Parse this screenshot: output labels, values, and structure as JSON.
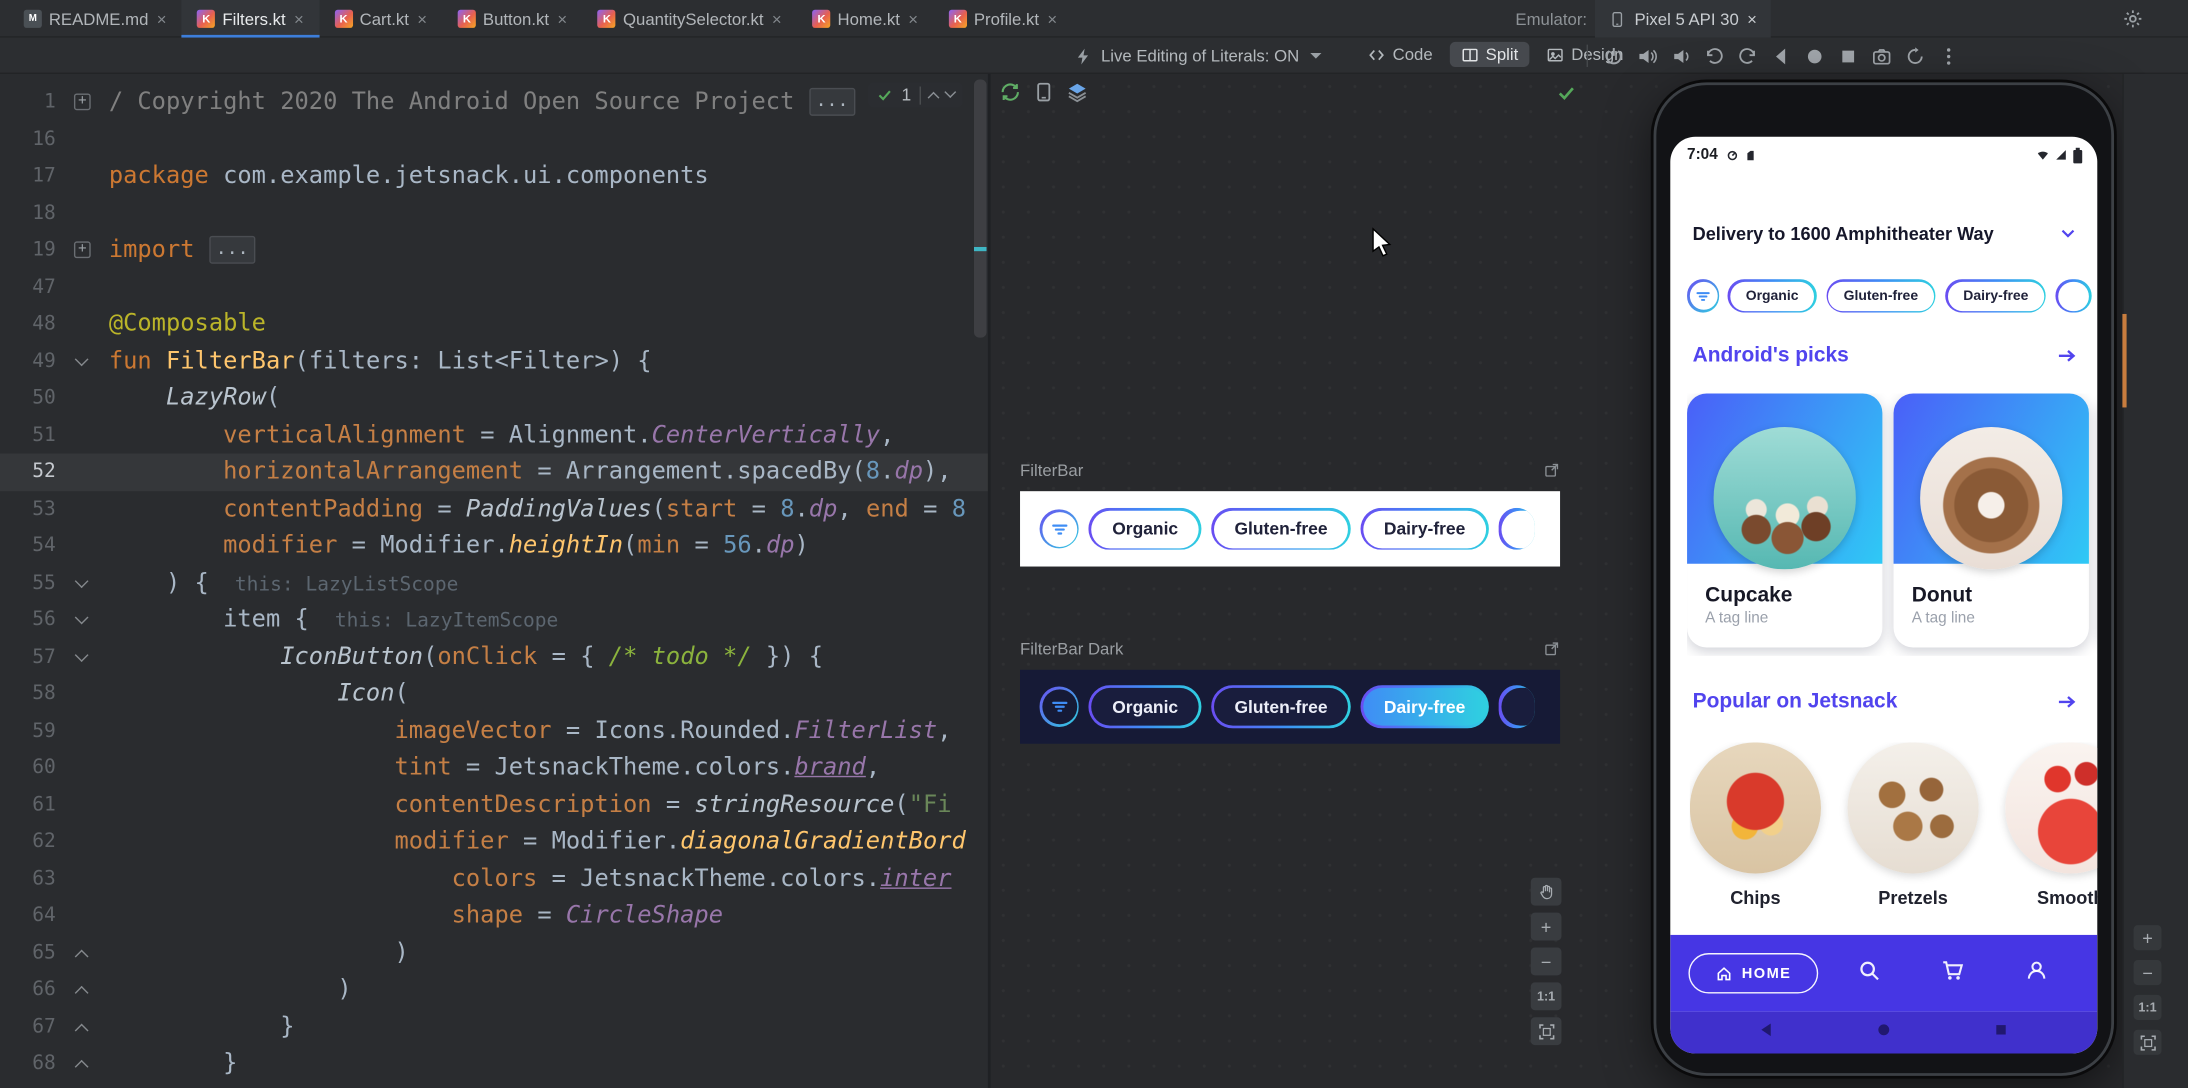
{
  "window": {
    "close_glyph": "×",
    "settings_icon": "settings-gear-icon"
  },
  "tabs": [
    {
      "label": "README.md",
      "badge": "M",
      "kind": "md",
      "active": false
    },
    {
      "label": "Filters.kt",
      "badge": "K",
      "kind": "kt",
      "active": true
    },
    {
      "label": "Cart.kt",
      "badge": "K",
      "kind": "kt",
      "active": false
    },
    {
      "label": "Button.kt",
      "badge": "K",
      "kind": "kt",
      "active": false
    },
    {
      "label": "QuantitySelector.kt",
      "badge": "K",
      "kind": "kt",
      "active": false
    },
    {
      "label": "Home.kt",
      "badge": "K",
      "kind": "kt",
      "active": false
    },
    {
      "label": "Profile.kt",
      "badge": "K",
      "kind": "kt",
      "active": false
    }
  ],
  "emulator_panel": {
    "prefix": "Emulator:",
    "tab": "Pixel 5 API 30",
    "tab_icon": "phone-icon"
  },
  "toolbar": {
    "live_edit_icon": "live-edit-bolt-icon",
    "live_edit": "Live Editing of Literals: ON",
    "view_modes": [
      {
        "label": "Code",
        "icon": "code-view-icon",
        "active": false
      },
      {
        "label": "Split",
        "icon": "split-view-icon",
        "active": true
      },
      {
        "label": "Design",
        "icon": "design-view-icon",
        "active": false
      }
    ],
    "emulator_buttons": [
      "power-icon",
      "volume-up-icon",
      "volume-down-icon",
      "rotate-left-icon",
      "rotate-right-icon",
      "back-icon",
      "home-circle-icon",
      "overview-square-icon",
      "camera-icon",
      "snapshot-icon",
      "more-kebab-icon"
    ]
  },
  "inspection": {
    "count": "1"
  },
  "editor": {
    "lines": [
      {
        "n": "1",
        "fold": "plus",
        "s": [
          {
            "t": "/ Copyright 2020 The Android Open Source Project ",
            "c": "cmt"
          },
          {
            "t": "...",
            "c": "fold"
          }
        ]
      },
      {
        "n": "16",
        "s": []
      },
      {
        "n": "17",
        "s": [
          {
            "t": "package ",
            "c": "kw"
          },
          {
            "t": "com.example.jetsnack.ui.components",
            "c": "d"
          }
        ]
      },
      {
        "n": "18",
        "s": []
      },
      {
        "n": "19",
        "fold": "plus",
        "s": [
          {
            "t": "import ",
            "c": "kw"
          },
          {
            "t": "...",
            "c": "fold"
          }
        ]
      },
      {
        "n": "47",
        "s": []
      },
      {
        "n": "48",
        "s": [
          {
            "t": "@Composable",
            "c": "ann"
          }
        ]
      },
      {
        "n": "49",
        "fold": "down",
        "s": [
          {
            "t": "fun ",
            "c": "kw"
          },
          {
            "t": "FilterBar",
            "c": "fnd"
          },
          {
            "t": "(filters: List<Filter>) {",
            "c": "d"
          }
        ]
      },
      {
        "n": "50",
        "s": [
          {
            "t": "    ",
            "c": "d"
          },
          {
            "t": "LazyRow",
            "c": "call"
          },
          {
            "t": "(",
            "c": "d"
          }
        ]
      },
      {
        "n": "51",
        "s": [
          {
            "t": "        ",
            "c": "d"
          },
          {
            "t": "verticalAlignment",
            "c": "na"
          },
          {
            "t": " = Alignment.",
            "c": "d"
          },
          {
            "t": "CenterVertically",
            "c": "prop"
          },
          {
            "t": ",",
            "c": "d"
          }
        ]
      },
      {
        "n": "52",
        "hl": true,
        "s": [
          {
            "t": "        ",
            "c": "d"
          },
          {
            "t": "horizontalArrangement",
            "c": "na"
          },
          {
            "t": " = Arrangement.spacedBy(",
            "c": "d"
          },
          {
            "t": "8",
            "c": "num"
          },
          {
            "t": ".",
            "c": "d"
          },
          {
            "t": "dp",
            "c": "prop"
          },
          {
            "t": "),",
            "c": "d"
          }
        ]
      },
      {
        "n": "53",
        "s": [
          {
            "t": "        ",
            "c": "d"
          },
          {
            "t": "contentPadding",
            "c": "na"
          },
          {
            "t": " = ",
            "c": "d"
          },
          {
            "t": "PaddingValues",
            "c": "call"
          },
          {
            "t": "(",
            "c": "d"
          },
          {
            "t": "start",
            "c": "na"
          },
          {
            "t": " = ",
            "c": "d"
          },
          {
            "t": "8",
            "c": "num"
          },
          {
            "t": ".",
            "c": "d"
          },
          {
            "t": "dp",
            "c": "prop"
          },
          {
            "t": ", ",
            "c": "d"
          },
          {
            "t": "end",
            "c": "na"
          },
          {
            "t": " = ",
            "c": "d"
          },
          {
            "t": "8",
            "c": "num"
          }
        ]
      },
      {
        "n": "54",
        "s": [
          {
            "t": "        ",
            "c": "d"
          },
          {
            "t": "modifier",
            "c": "na"
          },
          {
            "t": " = Modifier.",
            "c": "d"
          },
          {
            "t": "heightIn",
            "c": "callf"
          },
          {
            "t": "(",
            "c": "d"
          },
          {
            "t": "min",
            "c": "na"
          },
          {
            "t": " = ",
            "c": "d"
          },
          {
            "t": "56",
            "c": "num"
          },
          {
            "t": ".",
            "c": "d"
          },
          {
            "t": "dp",
            "c": "prop"
          },
          {
            "t": ")",
            "c": "d"
          }
        ]
      },
      {
        "n": "55",
        "fold": "down",
        "s": [
          {
            "t": "    ) { ",
            "c": "d"
          },
          {
            "t": " this: LazyListScope",
            "c": "hint"
          }
        ]
      },
      {
        "n": "56",
        "fold": "down",
        "s": [
          {
            "t": "        item { ",
            "c": "d"
          },
          {
            "t": " this: LazyItemScope",
            "c": "hint"
          }
        ]
      },
      {
        "n": "57",
        "fold": "down",
        "s": [
          {
            "t": "            ",
            "c": "d"
          },
          {
            "t": "IconButton",
            "c": "call"
          },
          {
            "t": "(",
            "c": "d"
          },
          {
            "t": "onClick",
            "c": "na"
          },
          {
            "t": " = { ",
            "c": "d"
          },
          {
            "t": "/* todo */",
            "c": "todo"
          },
          {
            "t": " }) {",
            "c": "d"
          }
        ]
      },
      {
        "n": "58",
        "s": [
          {
            "t": "                ",
            "c": "d"
          },
          {
            "t": "Icon",
            "c": "call"
          },
          {
            "t": "(",
            "c": "d"
          }
        ]
      },
      {
        "n": "59",
        "s": [
          {
            "t": "                    ",
            "c": "d"
          },
          {
            "t": "imageVector",
            "c": "na"
          },
          {
            "t": " = Icons.Rounded.",
            "c": "d"
          },
          {
            "t": "FilterList",
            "c": "prop"
          },
          {
            "t": ",",
            "c": "d"
          }
        ]
      },
      {
        "n": "60",
        "s": [
          {
            "t": "                    ",
            "c": "d"
          },
          {
            "t": "tint",
            "c": "na"
          },
          {
            "t": " = JetsnackTheme.colors.",
            "c": "d"
          },
          {
            "t": "brand",
            "c": "propu"
          },
          {
            "t": ",",
            "c": "d"
          }
        ]
      },
      {
        "n": "61",
        "s": [
          {
            "t": "                    ",
            "c": "d"
          },
          {
            "t": "contentDescription",
            "c": "na"
          },
          {
            "t": " = ",
            "c": "d"
          },
          {
            "t": "stringResource",
            "c": "call"
          },
          {
            "t": "(",
            "c": "d"
          },
          {
            "t": "\"Fi",
            "c": "str"
          }
        ]
      },
      {
        "n": "62",
        "s": [
          {
            "t": "                    ",
            "c": "d"
          },
          {
            "t": "modifier",
            "c": "na"
          },
          {
            "t": " = Modifier.",
            "c": "d"
          },
          {
            "t": "diagonalGradientBord",
            "c": "callf"
          }
        ]
      },
      {
        "n": "63",
        "s": [
          {
            "t": "                        ",
            "c": "d"
          },
          {
            "t": "colors",
            "c": "na"
          },
          {
            "t": " = JetsnackTheme.colors.",
            "c": "d"
          },
          {
            "t": "inter",
            "c": "propu"
          }
        ]
      },
      {
        "n": "64",
        "s": [
          {
            "t": "                        ",
            "c": "d"
          },
          {
            "t": "shape",
            "c": "na"
          },
          {
            "t": " = ",
            "c": "d"
          },
          {
            "t": "CircleShape",
            "c": "prop"
          }
        ]
      },
      {
        "n": "65",
        "fold": "up",
        "s": [
          {
            "t": "                    )",
            "c": "d"
          }
        ]
      },
      {
        "n": "66",
        "fold": "up",
        "s": [
          {
            "t": "                )",
            "c": "d"
          }
        ]
      },
      {
        "n": "67",
        "fold": "up",
        "s": [
          {
            "t": "            }",
            "c": "d"
          }
        ]
      },
      {
        "n": "68",
        "fold": "up",
        "s": [
          {
            "t": "        }",
            "c": "d"
          }
        ]
      }
    ]
  },
  "preview": {
    "toolbar_icons": [
      "build-refresh-icon",
      "device-preview-icon",
      "layers-icon"
    ],
    "status_icon": "success-check-icon",
    "groups": [
      {
        "label": "FilterBar",
        "theme": "light",
        "chips": [
          {
            "label": "Organic"
          },
          {
            "label": "Gluten-free"
          },
          {
            "label": "Dairy-free"
          },
          {
            "label": "",
            "partial": true
          }
        ]
      },
      {
        "label": "FilterBar Dark",
        "theme": "dark",
        "chips": [
          {
            "label": "Organic"
          },
          {
            "label": "Gluten-free"
          },
          {
            "label": "Dairy-free",
            "selected": true
          },
          {
            "label": "",
            "partial": true
          }
        ]
      }
    ],
    "zoom": {
      "plus": "+",
      "minus": "−",
      "actual": "1:1"
    }
  },
  "phone": {
    "time": "7:04",
    "status_icons_left": [
      "notification-dot-icon",
      "notification-sim-icon"
    ],
    "status_icons_right": [
      "wifi-icon",
      "signal-icon",
      "battery-icon"
    ],
    "delivery": "Delivery to 1600 Amphitheater Way",
    "filter_chips": [
      {
        "label": "Organic"
      },
      {
        "label": "Gluten-free"
      },
      {
        "label": "Dairy-free"
      },
      {
        "label": "",
        "partial": true
      }
    ],
    "picks": {
      "title": "Android's picks",
      "cards": [
        {
          "name": "Cupcake",
          "tag": "A tag line",
          "photo": "cupcake"
        },
        {
          "name": "Donut",
          "tag": "A tag line",
          "photo": "donut"
        },
        {
          "name": "",
          "tag": "",
          "photo": "",
          "partial": true
        }
      ]
    },
    "popular": {
      "title": "Popular on Jetsnack",
      "items": [
        {
          "name": "Chips",
          "photo": "chips"
        },
        {
          "name": "Pretzels",
          "photo": "pretzels"
        },
        {
          "name": "Smooth",
          "photo": "smoothie"
        }
      ]
    },
    "nav": {
      "home_label": "HOME",
      "home_icon": "home-icon",
      "icons": [
        "search-icon",
        "cart-icon",
        "profile-icon"
      ]
    },
    "android_nav": [
      "back-triangle-icon",
      "nav-home-circle-icon",
      "recents-square-icon"
    ]
  },
  "colors": {
    "tabAccent": "#3d7eda",
    "accent": "#5144ee",
    "g1": "#6a4df2",
    "g2": "#3f8df5",
    "g3": "#2fd0e0",
    "navBg": "#4636e4",
    "navDark": "#4030cc",
    "cardG1": "#4a5ff8",
    "cardG2": "#2fc9f5",
    "success": "#55a85a",
    "stripeOrange": "#c87d3e"
  }
}
